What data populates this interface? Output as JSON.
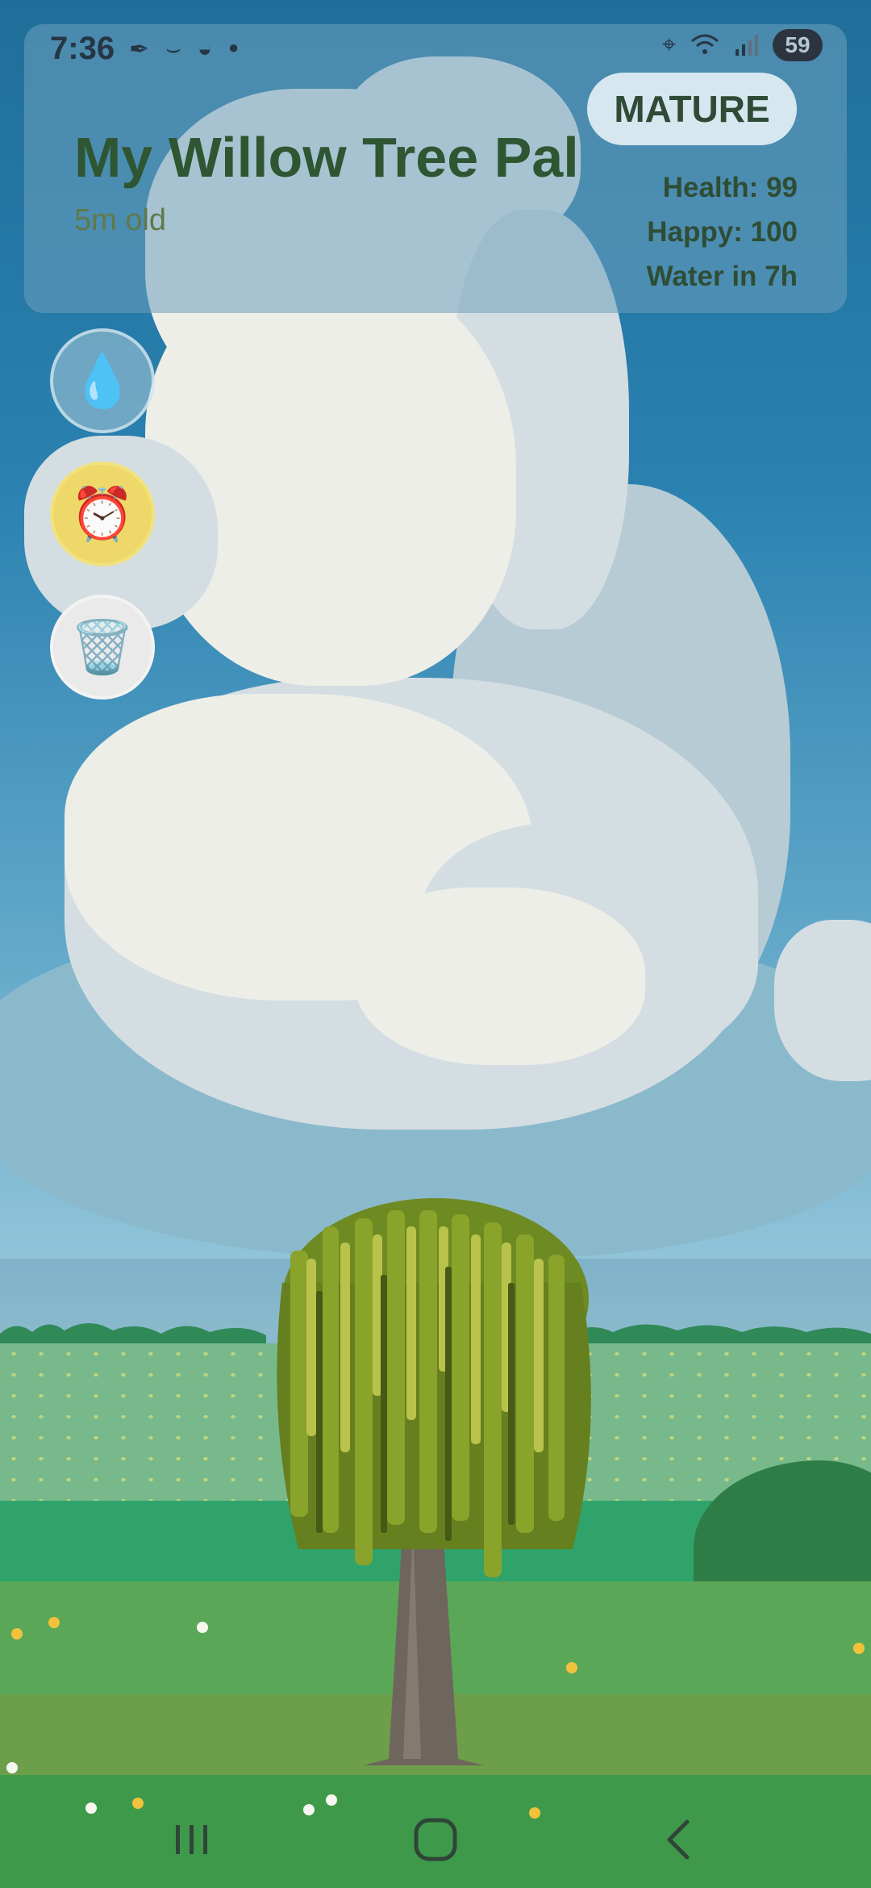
{
  "status_bar": {
    "time": "7:36",
    "left_icons": [
      "feather-icon",
      "amazon-smile-icon",
      "bowl-icon",
      "dot-icon"
    ],
    "right_icons": [
      "location-icon",
      "wifi-icon",
      "signal-icon"
    ],
    "battery": "59"
  },
  "header": {
    "pet_name": "My Willow Tree Pal",
    "age": "5m old",
    "stage": "MATURE",
    "stats": {
      "health": "Health: 99",
      "happy": "Happy: 100",
      "water": "Water in 7h"
    }
  },
  "actions": [
    {
      "name": "water",
      "icon": "💧"
    },
    {
      "name": "alarm",
      "icon": "⏰"
    },
    {
      "name": "trash",
      "icon": "🗑️"
    }
  ],
  "nav": [
    "recents",
    "home",
    "back"
  ],
  "colors": {
    "title": "#2f5632",
    "badge_bg": "#d6e7ef",
    "alarm_btn": "#eed86a",
    "sky": "#2a81b0",
    "grass": "#2fa36a"
  }
}
